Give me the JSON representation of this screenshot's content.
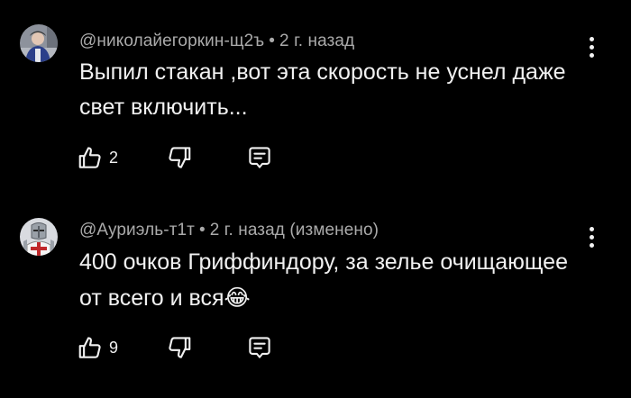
{
  "comments": [
    {
      "author": "@николайегоркин-щ2ъ",
      "time": "2 г. назад",
      "edited": "",
      "text": "Выпил стакан ,вот эта скорость не уснел даже свет включить...",
      "likes": "2",
      "avatar_icon": "profile-photo",
      "emoji": ""
    },
    {
      "author": "@Ауриэль-т1т",
      "time": "2 г. назад",
      "edited": "(изменено)",
      "text": "400 очков Гриффиндору, за зелье очищающее от всего и вся",
      "likes": "9",
      "avatar_icon": "knight-avatar",
      "emoji": "😂"
    }
  ],
  "icons": {
    "like": "thumb-up-icon",
    "dislike": "thumb-down-icon",
    "reply": "reply-icon",
    "more": "more-vertical-icon"
  },
  "colors": {
    "background": "#000000",
    "primary_text": "#f1f1f1",
    "secondary_text": "#aaaaaa",
    "emoji": "#f5c518"
  }
}
